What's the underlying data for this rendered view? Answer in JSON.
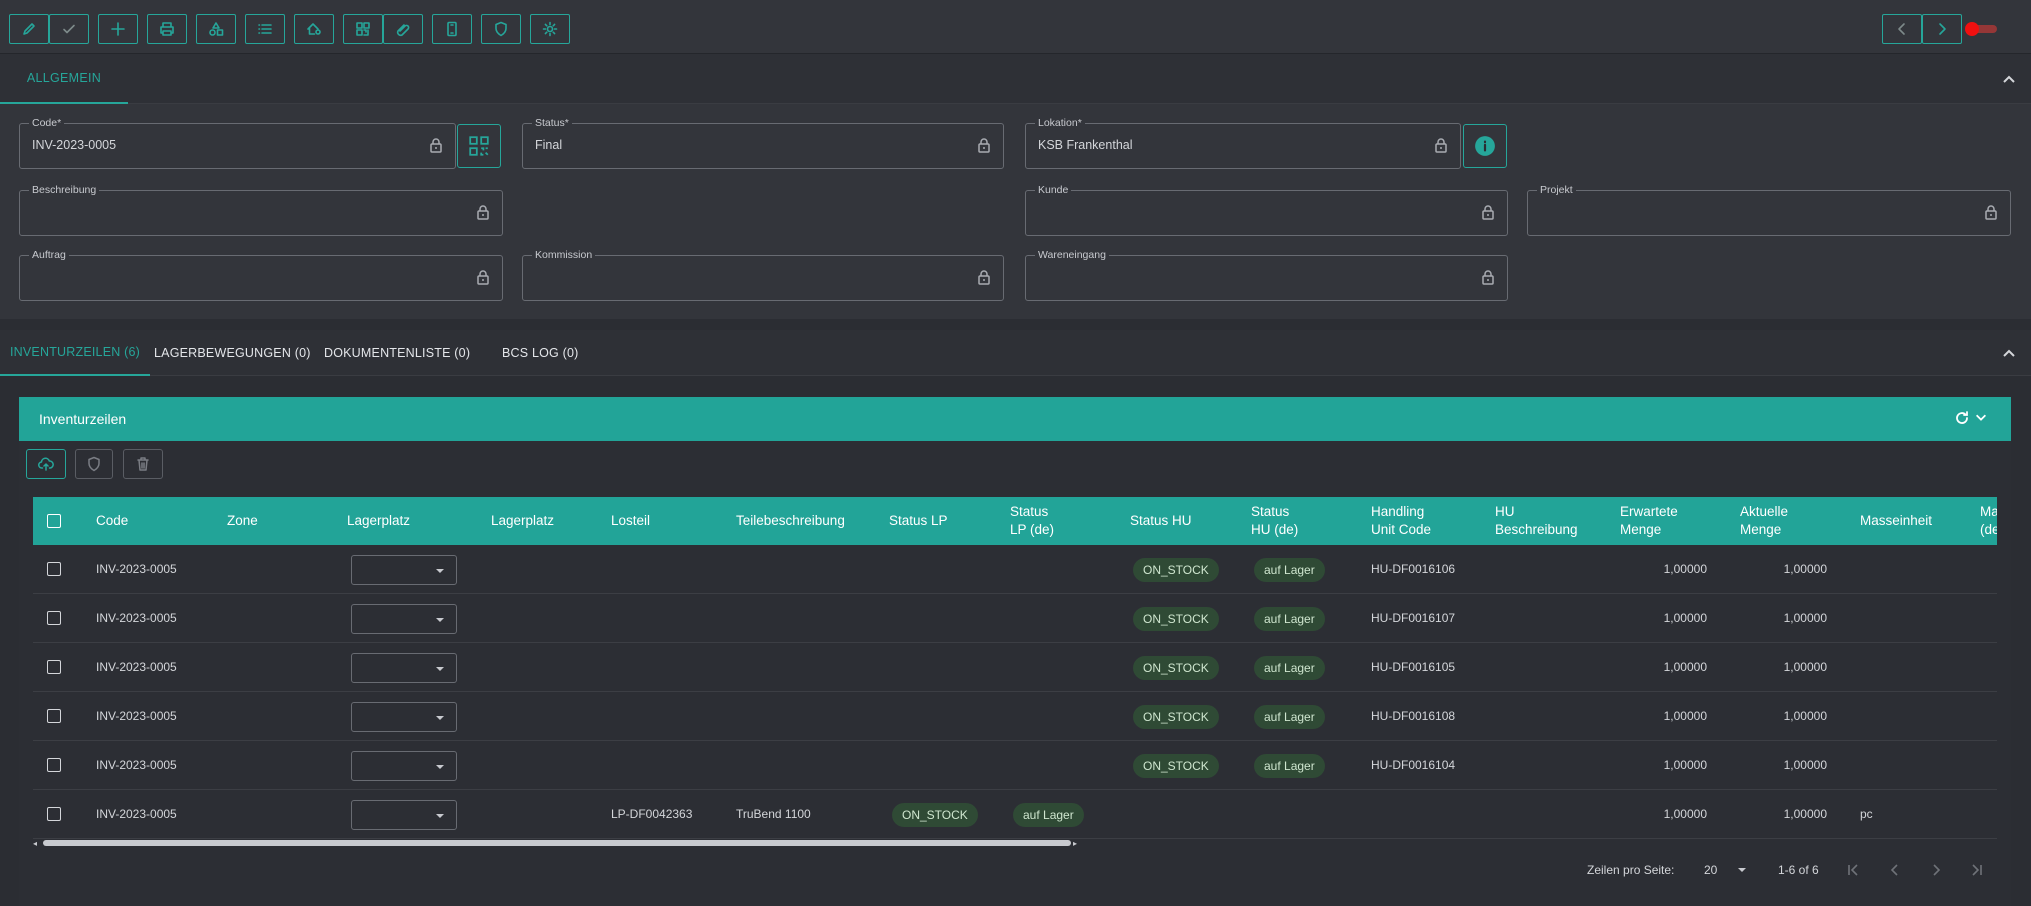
{
  "toolbar": {
    "buttons": [
      "edit",
      "confirm",
      "add",
      "print",
      "shapes",
      "list",
      "location-tag",
      "qr",
      "link",
      "mobile",
      "shield",
      "settings"
    ],
    "nav": [
      "previous",
      "next"
    ],
    "toggle_color": "#f01010"
  },
  "general": {
    "tab_label": "ALLGEMEIN",
    "fields": {
      "code": {
        "label": "Code*",
        "value": "INV-2023-0005"
      },
      "status": {
        "label": "Status*",
        "value": "Final"
      },
      "lokation": {
        "label": "Lokation*",
        "value": "KSB Frankenthal"
      },
      "beschreibung": {
        "label": "Beschreibung",
        "value": ""
      },
      "kunde": {
        "label": "Kunde",
        "value": ""
      },
      "projekt": {
        "label": "Projekt",
        "value": ""
      },
      "auftrag": {
        "label": "Auftrag",
        "value": ""
      },
      "kommission": {
        "label": "Kommission",
        "value": ""
      },
      "wareneingang": {
        "label": "Wareneingang",
        "value": ""
      }
    }
  },
  "tabs": [
    {
      "label": "INVENTURZEILEN (6)",
      "active": true
    },
    {
      "label": "LAGERBEWEGUNGEN (0)",
      "active": false
    },
    {
      "label": "DOKUMENTENLISTE (0)",
      "active": false
    },
    {
      "label": "BCS LOG (0)",
      "active": false
    }
  ],
  "grid": {
    "title": "Inventurzeilen",
    "columns": [
      "Code",
      "Zone",
      "Lagerplatz",
      "Lagerplatz",
      "Losteil",
      "Teilebeschreibung",
      "Status LP",
      "Status LP (de)",
      "Status HU",
      "Status HU (de)",
      "Handling Unit Code",
      "HU Beschreibung",
      "Erwartete Menge",
      "Aktuelle Menge",
      "Masseinheit",
      "Ma (de"
    ],
    "rows": [
      {
        "code": "INV-2023-0005",
        "losteil": "",
        "teilebeschreibung": "",
        "status_lp": "",
        "status_lp_de": "",
        "status_hu": "ON_STOCK",
        "status_hu_de": "auf Lager",
        "hu_code": "HU-DF0016106",
        "erwartete": "1,00000",
        "aktuelle": "1,00000",
        "masseinheit": ""
      },
      {
        "code": "INV-2023-0005",
        "losteil": "",
        "teilebeschreibung": "",
        "status_lp": "",
        "status_lp_de": "",
        "status_hu": "ON_STOCK",
        "status_hu_de": "auf Lager",
        "hu_code": "HU-DF0016107",
        "erwartete": "1,00000",
        "aktuelle": "1,00000",
        "masseinheit": ""
      },
      {
        "code": "INV-2023-0005",
        "losteil": "",
        "teilebeschreibung": "",
        "status_lp": "",
        "status_lp_de": "",
        "status_hu": "ON_STOCK",
        "status_hu_de": "auf Lager",
        "hu_code": "HU-DF0016105",
        "erwartete": "1,00000",
        "aktuelle": "1,00000",
        "masseinheit": ""
      },
      {
        "code": "INV-2023-0005",
        "losteil": "",
        "teilebeschreibung": "",
        "status_lp": "",
        "status_lp_de": "",
        "status_hu": "ON_STOCK",
        "status_hu_de": "auf Lager",
        "hu_code": "HU-DF0016108",
        "erwartete": "1,00000",
        "aktuelle": "1,00000",
        "masseinheit": ""
      },
      {
        "code": "INV-2023-0005",
        "losteil": "",
        "teilebeschreibung": "",
        "status_lp": "",
        "status_lp_de": "",
        "status_hu": "ON_STOCK",
        "status_hu_de": "auf Lager",
        "hu_code": "HU-DF0016104",
        "erwartete": "1,00000",
        "aktuelle": "1,00000",
        "masseinheit": ""
      },
      {
        "code": "INV-2023-0005",
        "losteil": "LP-DF0042363",
        "teilebeschreibung": "TruBend 1100",
        "status_lp": "ON_STOCK",
        "status_lp_de": "auf Lager",
        "status_hu": "",
        "status_hu_de": "",
        "hu_code": "",
        "erwartete": "1,00000",
        "aktuelle": "1,00000",
        "masseinheit": "pc"
      }
    ]
  },
  "pagination": {
    "rows_per_page_label": "Zeilen pro Seite:",
    "rows_per_page": "20",
    "range": "1-6 of 6"
  },
  "colors": {
    "accent": "#26a69a",
    "header": "#22a498",
    "chip_bg": "#2f4a35"
  }
}
